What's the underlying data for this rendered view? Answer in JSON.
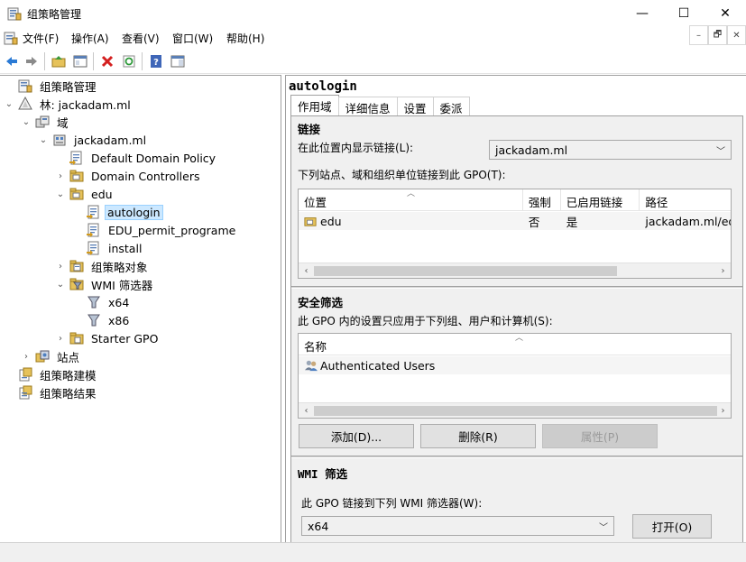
{
  "window": {
    "title": "组策略管理"
  },
  "window_controls": {
    "minimize": "—",
    "maximize": "☐",
    "close": "✕"
  },
  "menu": [
    "文件(F)",
    "操作(A)",
    "查看(V)",
    "窗口(W)",
    "帮助(H)"
  ],
  "mdi_controls": [
    "–",
    "🗗",
    "✕"
  ],
  "tree": {
    "items": [
      {
        "label": "组策略管理",
        "level": 0,
        "twisty": "",
        "icon": "gpm-root-icon"
      },
      {
        "label": "林: jackadam.ml",
        "level": 0,
        "twisty": "⌄",
        "icon": "forest-icon"
      },
      {
        "label": "域",
        "level": 1,
        "twisty": "⌄",
        "icon": "domains-icon"
      },
      {
        "label": "jackadam.ml",
        "level": 2,
        "twisty": "⌄",
        "icon": "domain-icon"
      },
      {
        "label": "Default Domain Policy",
        "level": 3,
        "twisty": "",
        "icon": "gpo-link-icon"
      },
      {
        "label": "Domain Controllers",
        "level": 3,
        "twisty": "›",
        "icon": "ou-folder-icon"
      },
      {
        "label": "edu",
        "level": 3,
        "twisty": "⌄",
        "icon": "ou-folder-icon"
      },
      {
        "label": "autologin",
        "level": 4,
        "twisty": "",
        "icon": "gpo-link-icon",
        "selected": true
      },
      {
        "label": "EDU_permit_programe",
        "level": 4,
        "twisty": "",
        "icon": "gpo-link-icon"
      },
      {
        "label": "install",
        "level": 4,
        "twisty": "",
        "icon": "gpo-link-icon"
      },
      {
        "label": "组策略对象",
        "level": 3,
        "twisty": "›",
        "icon": "gpo-folder-icon"
      },
      {
        "label": "WMI 筛选器",
        "level": 3,
        "twisty": "⌄",
        "icon": "wmi-folder-icon"
      },
      {
        "label": "x64",
        "level": 4,
        "twisty": "",
        "icon": "wmi-filter-icon"
      },
      {
        "label": "x86",
        "level": 4,
        "twisty": "",
        "icon": "wmi-filter-icon"
      },
      {
        "label": "Starter GPO",
        "level": 3,
        "twisty": "›",
        "icon": "starter-folder-icon"
      },
      {
        "label": "站点",
        "level": 1,
        "twisty": "›",
        "icon": "sites-icon"
      },
      {
        "label": "组策略建模",
        "level": 0,
        "twisty": "",
        "icon": "modeling-icon"
      },
      {
        "label": "组策略结果",
        "level": 0,
        "twisty": "",
        "icon": "results-icon"
      }
    ]
  },
  "gpo": {
    "name": "autologin",
    "tabs": [
      "作用域",
      "详细信息",
      "设置",
      "委派"
    ],
    "links": {
      "title": "链接",
      "show_links_label": "在此位置内显示链接(L):",
      "location_value": "jackadam.ml",
      "linked_label": "下列站点、域和组织单位链接到此 GPO(T):",
      "columns": [
        "位置",
        "强制",
        "已启用链接",
        "路径"
      ],
      "rows": [
        {
          "location": "edu",
          "enforced": "否",
          "enabled": "是",
          "path": "jackadam.ml/edu"
        }
      ]
    },
    "security": {
      "title": "安全筛选",
      "label": "此 GPO 内的设置只应用于下列组、用户和计算机(S):",
      "columns": [
        "名称"
      ],
      "rows": [
        {
          "name": "Authenticated Users"
        }
      ],
      "add_label": "添加(D)...",
      "remove_label": "删除(R)",
      "properties_label": "属性(P)"
    },
    "wmi": {
      "title": "WMI 筛选",
      "label": "此 GPO 链接到下列 WMI 筛选器(W):",
      "value": "x64",
      "open_label": "打开(O)"
    }
  }
}
